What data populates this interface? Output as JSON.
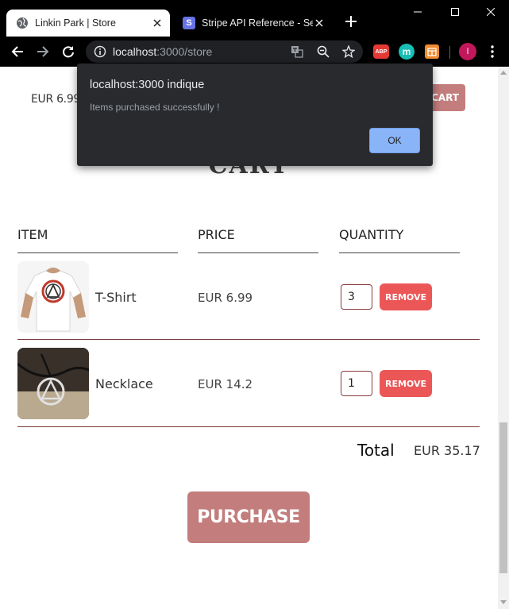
{
  "browser": {
    "tabs": [
      {
        "title": "Linkin Park | Store",
        "active": true
      },
      {
        "title": "Stripe API Reference - Sessions",
        "active": false
      }
    ],
    "stripe_favicon_letter": "S",
    "url_host": "localhost",
    "url_path": ":3000/store",
    "extensions": {
      "abp_label": "ABP",
      "profile_initial": "I"
    },
    "colors": {
      "chrome_bg": "#000000",
      "omnibox_bg": "#202124"
    }
  },
  "page": {
    "top_item_price": "EUR 6.99",
    "top_cart_button": "CART",
    "cart_title": "CART",
    "columns": {
      "item": "ITEM",
      "price": "PRICE",
      "quantity": "QUANTITY"
    },
    "items": [
      {
        "name": "T-Shirt",
        "price": "EUR 6.99",
        "quantity": "3",
        "remove_label": "REMOVE"
      },
      {
        "name": "Necklace",
        "price": "EUR 14.2",
        "quantity": "1",
        "remove_label": "REMOVE"
      }
    ],
    "total_label": "Total",
    "total_value": "EUR 35.17",
    "purchase_label": "PURCHASE",
    "colors": {
      "accent": "#c37d7d",
      "remove": "#eb5757"
    }
  },
  "dialog": {
    "title": "localhost:3000 indique",
    "message": "Items purchased successfully !",
    "ok_label": "OK"
  }
}
